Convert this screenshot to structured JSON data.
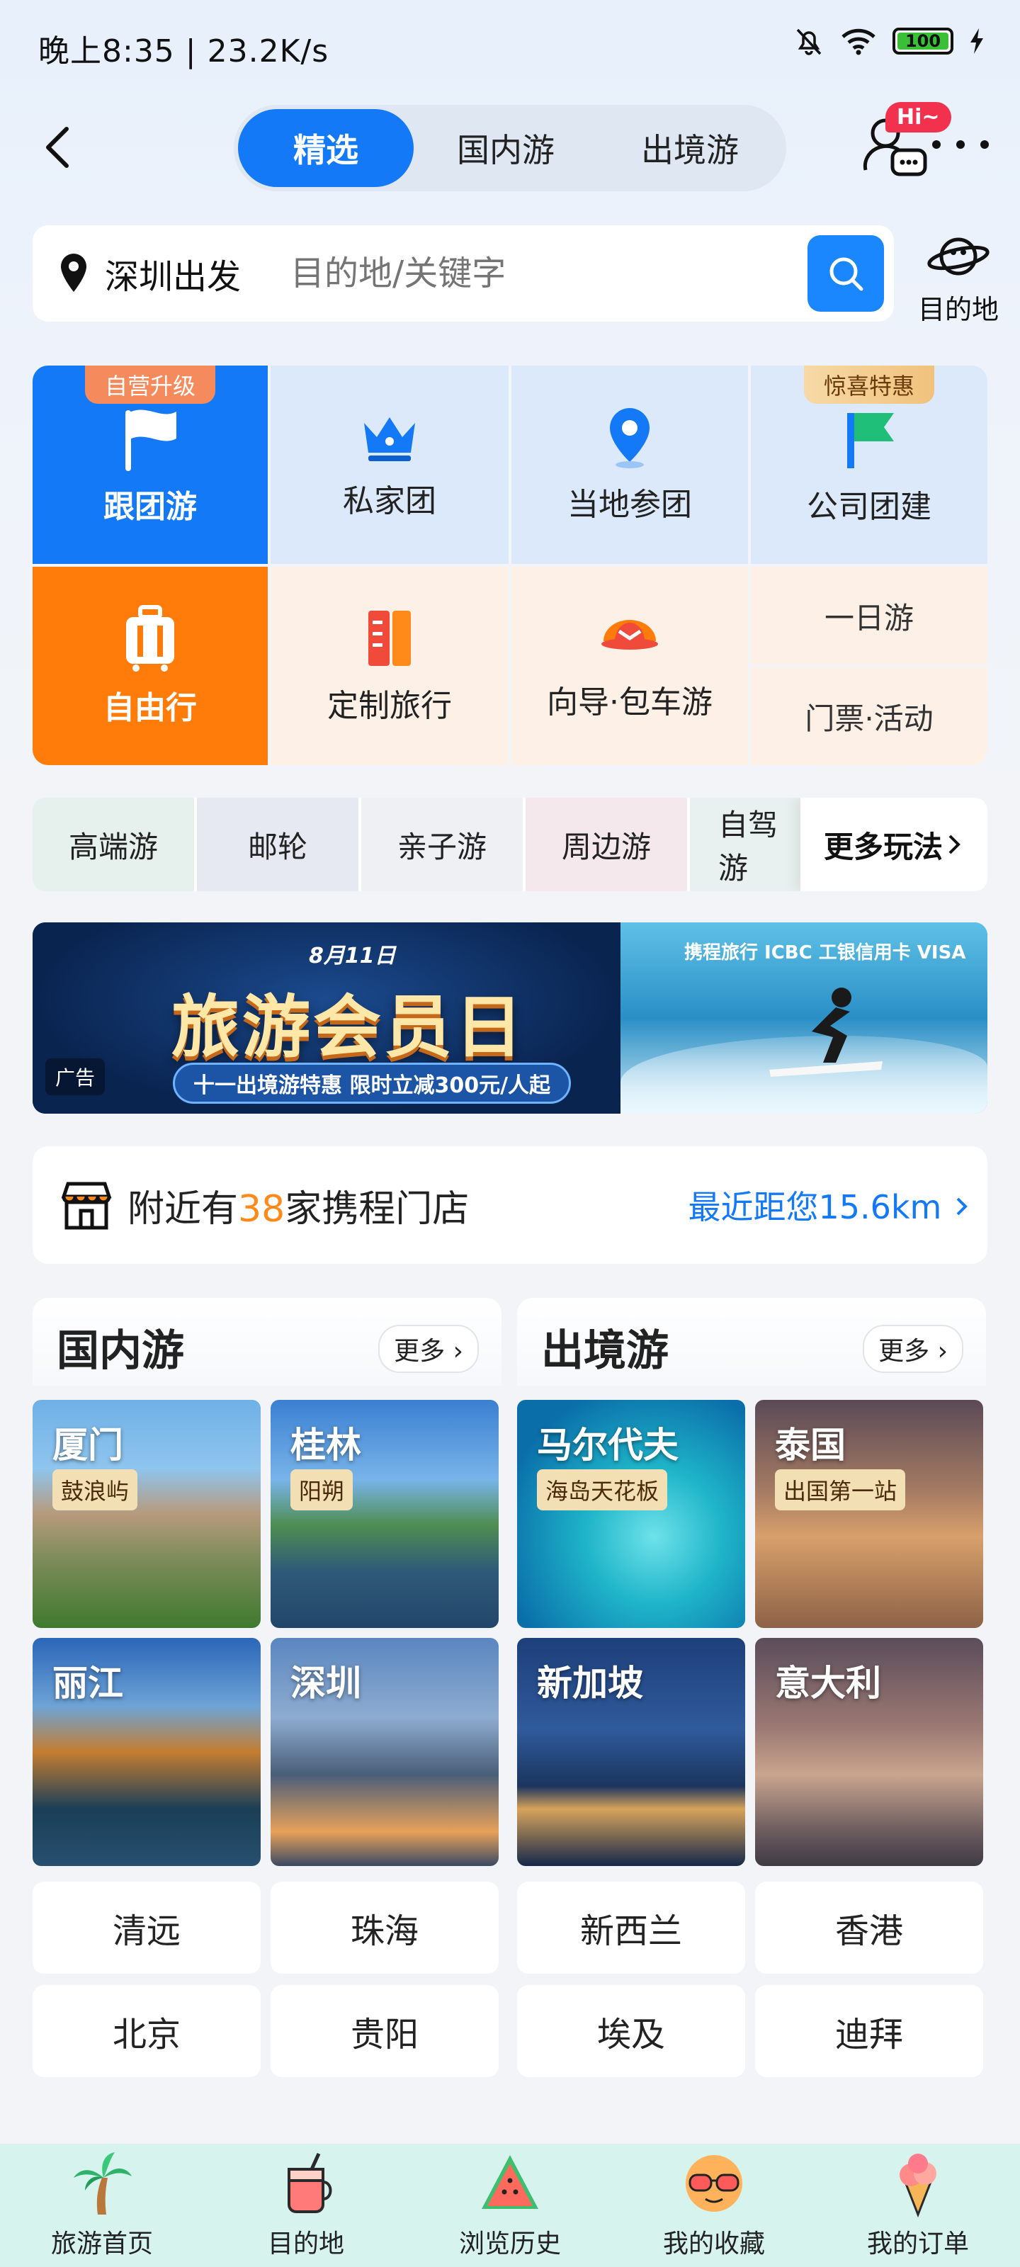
{
  "status": {
    "time_speed": "晚上8:35 | 23.2K/s",
    "battery": "100"
  },
  "nav": {
    "tabs": [
      {
        "label": "精选"
      },
      {
        "label": "国内游"
      },
      {
        "label": "出境游"
      }
    ],
    "badge": "Hi~"
  },
  "search": {
    "departure": "深圳出发",
    "placeholder": "目的地/关键字",
    "dest_label": "目的地"
  },
  "categories": {
    "group_tour": {
      "label": "跟团游",
      "tag": "自营升级"
    },
    "private_group": {
      "label": "私家团"
    },
    "local_tour": {
      "label": "当地参团"
    },
    "company_build": {
      "label": "公司团建",
      "tag": "惊喜特惠"
    },
    "free_travel": {
      "label": "自由行"
    },
    "custom_travel": {
      "label": "定制旅行"
    },
    "guide_car": {
      "label": "向导·包车游"
    },
    "day_tour": {
      "label": "一日游"
    },
    "tickets": {
      "label": "门票·活动"
    }
  },
  "themes": {
    "items": [
      "高端游",
      "邮轮",
      "亲子游",
      "周边游",
      "自驾游"
    ],
    "more": "更多玩法"
  },
  "banner": {
    "date": "8月11日",
    "title": "旅游会员日",
    "subtitle": "十一出境游特惠 限时立减300元/人起",
    "ad": "广告",
    "brand": "携程旅行 ICBC 工银信用卡 VISA"
  },
  "store": {
    "prefix": "附近有",
    "count": "38",
    "suffix": "家携程门店",
    "distance": "最近距您15.6km"
  },
  "domestic": {
    "title": "国内游",
    "more": "更多",
    "tiles": [
      {
        "name": "厦门",
        "tag": "鼓浪屿"
      },
      {
        "name": "桂林",
        "tag": "阳朔"
      },
      {
        "name": "丽江"
      },
      {
        "name": "深圳"
      }
    ],
    "cities": [
      "清远",
      "珠海",
      "北京",
      "贵阳"
    ]
  },
  "outbound": {
    "title": "出境游",
    "more": "更多",
    "tiles": [
      {
        "name": "马尔代夫",
        "tag": "海岛天花板"
      },
      {
        "name": "泰国",
        "tag": "出国第一站"
      },
      {
        "name": "新加坡"
      },
      {
        "name": "意大利"
      }
    ],
    "cities": [
      "新西兰",
      "香港",
      "埃及",
      "迪拜"
    ]
  },
  "tabbar": {
    "items": [
      {
        "label": "旅游首页",
        "icon": "palm-tree-icon"
      },
      {
        "label": "目的地",
        "icon": "drink-cup-icon"
      },
      {
        "label": "浏览历史",
        "icon": "watermelon-icon"
      },
      {
        "label": "我的收藏",
        "icon": "sunglasses-icon"
      },
      {
        "label": "我的订单",
        "icon": "ice-cream-icon"
      }
    ]
  }
}
